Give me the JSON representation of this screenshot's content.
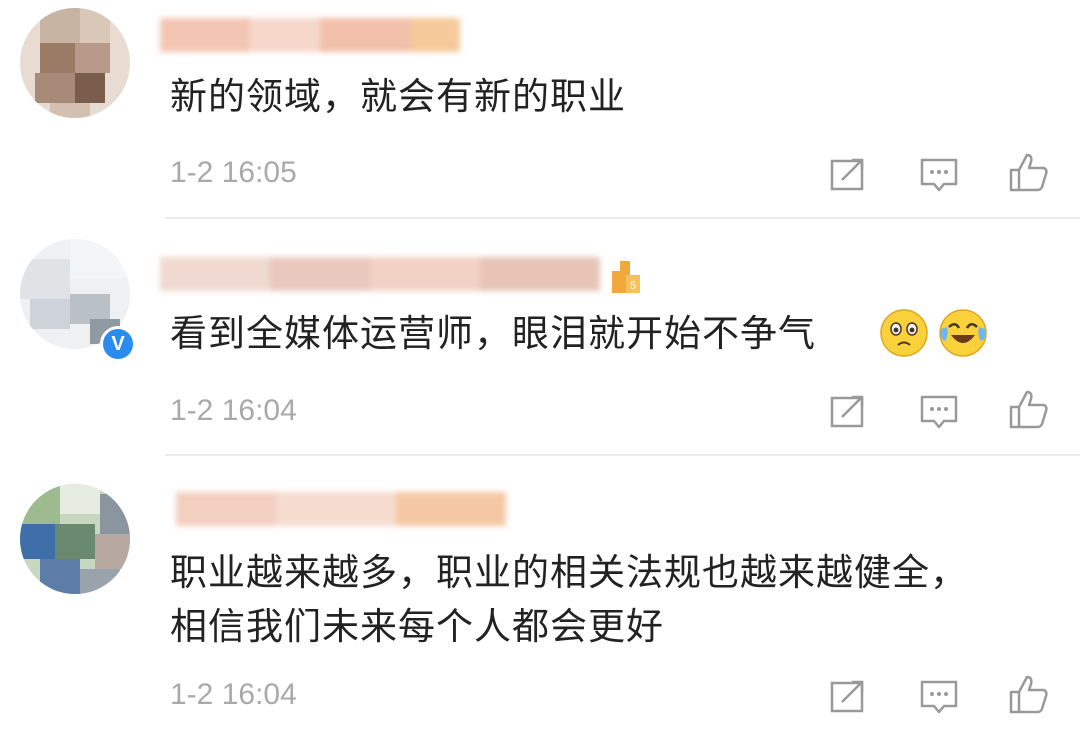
{
  "comments": [
    {
      "text": "新的领域，就会有新的职业",
      "time": "1-2 16:05",
      "emojis": []
    },
    {
      "text": "看到全媒体运营师，眼泪就开始不争气",
      "time": "1-2 16:04",
      "verified": "V",
      "emojis": [
        "tearful-face-emoji",
        "laughing-crying-emoji"
      ]
    },
    {
      "text": "职业越来越多，职业的相关法规也越来越健全，\n相信我们未来每个人都会更好",
      "time": "1-2 16:04",
      "emojis": []
    }
  ],
  "icons": {
    "share": "share-icon",
    "comment": "comment-icon",
    "like": "thumbs-up-icon"
  },
  "colors": {
    "text": "#222222",
    "time": "#a9a9a9",
    "icon": "#999999",
    "verified": "#2a8cf0"
  }
}
